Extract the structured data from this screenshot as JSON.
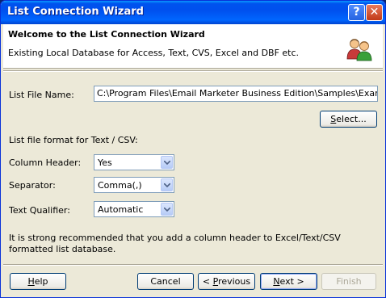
{
  "window": {
    "title": "List Connection Wizard"
  },
  "titlebar": {
    "help_glyph": "?",
    "close_glyph": "✕"
  },
  "header": {
    "title": "Welcome to the List Connection Wizard",
    "subtitle": "Existing Local Database for Access, Text, CVS, Excel and DBF etc.",
    "icon": "users-icon"
  },
  "form": {
    "list_file_label": "List File Name:",
    "list_file_value": "C:\\Program Files\\Email Marketer Business Edition\\Samples\\Example.csv",
    "select_button": {
      "pre": "",
      "key": "S",
      "post": "elect..."
    },
    "format_heading": "List file format for Text / CSV:",
    "column_header_label": "Column Header:",
    "column_header_value": "Yes",
    "separator_label": "Separator:",
    "separator_value": "Comma(,)",
    "text_qualifier_label": "Text Qualifier:",
    "text_qualifier_value": "Automatic",
    "note": "It is strong recommended that you add a column header to Excel/Text/CSV formatted list database."
  },
  "footer": {
    "help": {
      "pre": "",
      "key": "H",
      "post": "elp"
    },
    "cancel": "Cancel",
    "previous": {
      "pre": "< ",
      "key": "P",
      "post": "revious"
    },
    "next": {
      "pre": "",
      "key": "N",
      "post": "ext >"
    },
    "finish": "Finish"
  },
  "colors": {
    "title_bar": "#0053ee",
    "dialog_bg": "#ece9d8",
    "field_border": "#7f9db9"
  }
}
